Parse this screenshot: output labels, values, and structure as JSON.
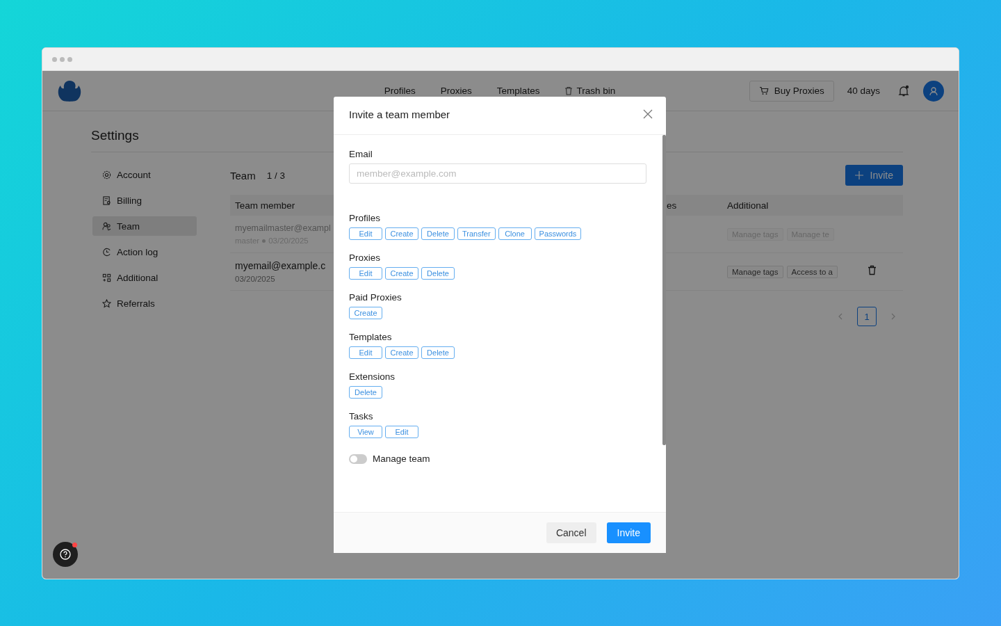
{
  "header": {
    "nav": [
      {
        "label": "Profiles",
        "kind": "plain"
      },
      {
        "label": "Proxies",
        "kind": "plain"
      },
      {
        "label": "Templates",
        "kind": "plain"
      },
      {
        "label": "Trash bin",
        "kind": "trash"
      }
    ],
    "buy_button": "Buy Proxies",
    "days_left": "40 days",
    "notifications": {
      "unread": true
    }
  },
  "page_title": "Settings",
  "sidebar": {
    "items": [
      {
        "label": "Account",
        "kind": "gear",
        "selected": false
      },
      {
        "label": "Billing",
        "kind": "receipt",
        "selected": false
      },
      {
        "label": "Team",
        "kind": "people",
        "selected": true
      },
      {
        "label": "Action log",
        "kind": "clock",
        "selected": false
      },
      {
        "label": "Additional",
        "kind": "grid",
        "selected": false
      },
      {
        "label": "Referrals",
        "kind": "star",
        "selected": false
      }
    ]
  },
  "team": {
    "title": "Team",
    "count": "1 / 3",
    "invite_button": "Invite",
    "columns": [
      "Team member",
      "es",
      "Additional"
    ],
    "rows": [
      {
        "member": "myemailmaster@exampl",
        "role": "master",
        "date": "03/20/2025",
        "disabled": true,
        "tags": [
          "Manage tags",
          "Manage te"
        ],
        "deletable": false
      },
      {
        "member": "myemail@example.c",
        "date": "03/20/2025",
        "disabled": false,
        "tags": [
          "Manage tags",
          "Access to a"
        ],
        "deletable": true
      }
    ],
    "pages": [
      {
        "label": "1",
        "selected": true
      }
    ]
  },
  "help": {
    "badge": true
  },
  "modal": {
    "title": "Invite a team member",
    "email": {
      "label": "Email",
      "placeholder": "member@example.com"
    },
    "groups": [
      {
        "label": "Profiles",
        "permissions": [
          "Edit",
          "Create",
          "Delete",
          "Transfer",
          "Clone",
          "Passwords"
        ]
      },
      {
        "label": "Proxies",
        "permissions": [
          "Edit",
          "Create",
          "Delete"
        ]
      },
      {
        "label": "Paid Proxies",
        "permissions": [
          "Create"
        ]
      },
      {
        "label": "Templates",
        "permissions": [
          "Edit",
          "Create",
          "Delete"
        ]
      },
      {
        "label": "Extensions",
        "permissions": [
          "Delete"
        ]
      },
      {
        "label": "Tasks",
        "permissions": [
          "View",
          "Edit"
        ]
      }
    ],
    "manage_team": {
      "label": "Manage team",
      "on": false
    },
    "cancel_button": "Cancel",
    "invite_button": "Invite"
  }
}
